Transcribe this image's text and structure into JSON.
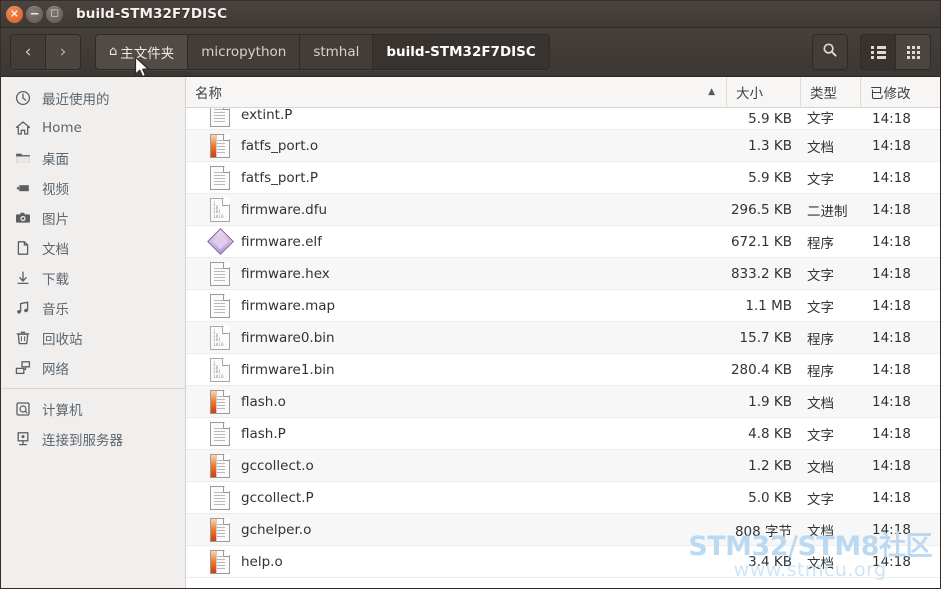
{
  "window": {
    "title": "build-STM32F7DISC",
    "controls": [
      {
        "name": "close",
        "glyph": "✕"
      },
      {
        "name": "minimize",
        "glyph": "−"
      },
      {
        "name": "maximize",
        "glyph": "□"
      }
    ]
  },
  "toolbar": {
    "back_glyph": "‹",
    "forward_glyph": "›",
    "home_icon": "⌂",
    "breadcrumbs": [
      {
        "label": "主文件夹",
        "state": "hover",
        "has_home_icon": true
      },
      {
        "label": "micropython",
        "state": "normal",
        "has_home_icon": false
      },
      {
        "label": "stmhal",
        "state": "normal",
        "has_home_icon": false
      },
      {
        "label": "build-STM32F7DISC",
        "state": "active",
        "has_home_icon": false
      }
    ],
    "search_label": "搜索",
    "list_view_label": "列表视图",
    "grid_view_label": "图标视图"
  },
  "sidebar": {
    "items": [
      {
        "label": "最近使用的",
        "icon": "clock-icon"
      },
      {
        "label": "Home",
        "icon": "home-icon"
      },
      {
        "label": "桌面",
        "icon": "folder-icon"
      },
      {
        "label": "视频",
        "icon": "video-icon"
      },
      {
        "label": "图片",
        "icon": "camera-icon"
      },
      {
        "label": "文档",
        "icon": "document-icon"
      },
      {
        "label": "下载",
        "icon": "download-icon"
      },
      {
        "label": "音乐",
        "icon": "music-icon"
      },
      {
        "label": "回收站",
        "icon": "trash-icon"
      },
      {
        "label": "网络",
        "icon": "network-icon"
      }
    ],
    "items2": [
      {
        "label": "计算机",
        "icon": "computer-icon"
      },
      {
        "label": "连接到服务器",
        "icon": "server-icon"
      }
    ]
  },
  "file_list": {
    "columns": {
      "name": "名称",
      "size": "大小",
      "type": "类型",
      "modified": "已修改"
    },
    "sort": {
      "column": "名称",
      "direction": "ascending",
      "arrow": "▲"
    },
    "rows": [
      {
        "name": "extint.P",
        "size": "5.9 KB",
        "type": "文字",
        "modified": "14:18",
        "icon": "text-file-icon",
        "partial": true
      },
      {
        "name": "fatfs_port.o",
        "size": "1.3 KB",
        "type": "文档",
        "modified": "14:18",
        "icon": "object-file-icon"
      },
      {
        "name": "fatfs_port.P",
        "size": "5.9 KB",
        "type": "文字",
        "modified": "14:18",
        "icon": "text-file-icon"
      },
      {
        "name": "firmware.dfu",
        "size": "296.5 KB",
        "type": "二进制",
        "modified": "14:18",
        "icon": "binary-file-icon"
      },
      {
        "name": "firmware.elf",
        "size": "672.1 KB",
        "type": "程序",
        "modified": "14:18",
        "icon": "executable-file-icon"
      },
      {
        "name": "firmware.hex",
        "size": "833.2 KB",
        "type": "文字",
        "modified": "14:18",
        "icon": "text-file-icon"
      },
      {
        "name": "firmware.map",
        "size": "1.1 MB",
        "type": "文字",
        "modified": "14:18",
        "icon": "text-file-icon"
      },
      {
        "name": "firmware0.bin",
        "size": "15.7 KB",
        "type": "程序",
        "modified": "14:18",
        "icon": "binary-file-icon"
      },
      {
        "name": "firmware1.bin",
        "size": "280.4 KB",
        "type": "程序",
        "modified": "14:18",
        "icon": "binary-file-icon"
      },
      {
        "name": "flash.o",
        "size": "1.9 KB",
        "type": "文档",
        "modified": "14:18",
        "icon": "object-file-icon"
      },
      {
        "name": "flash.P",
        "size": "4.8 KB",
        "type": "文字",
        "modified": "14:18",
        "icon": "text-file-icon"
      },
      {
        "name": "gccollect.o",
        "size": "1.2 KB",
        "type": "文档",
        "modified": "14:18",
        "icon": "object-file-icon"
      },
      {
        "name": "gccollect.P",
        "size": "5.0 KB",
        "type": "文字",
        "modified": "14:18",
        "icon": "text-file-icon"
      },
      {
        "name": "gchelper.o",
        "size": "808 字节",
        "type": "文档",
        "modified": "14:18",
        "icon": "object-file-icon"
      },
      {
        "name": "help.o",
        "size": "3.4 KB",
        "type": "文档",
        "modified": "14:18",
        "icon": "object-file-icon"
      }
    ]
  },
  "watermark": {
    "line1": "STM32/STM8社区",
    "line2": "www.stmcu.org"
  },
  "colors": {
    "titlebar": "#413b37",
    "toolbar": "#423c38",
    "sidebar_bg": "#f0efed",
    "file_bg": "#ffffff",
    "close_button": "#dc5a20",
    "watermark": "#bcd9f2",
    "text": "#2f3436"
  }
}
